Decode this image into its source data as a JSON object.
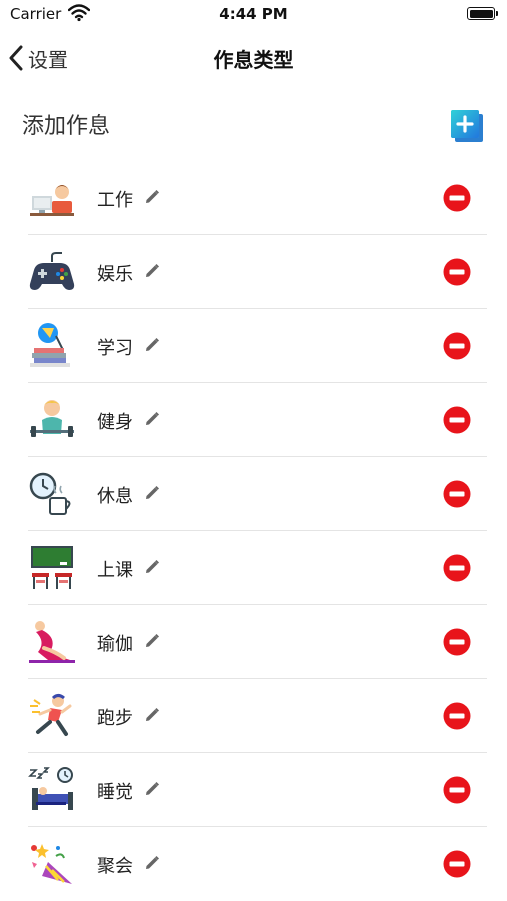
{
  "status_bar": {
    "carrier": "Carrier",
    "time": "4:44 PM"
  },
  "nav": {
    "back_label": "设置",
    "title": "作息类型"
  },
  "section": {
    "title": "添加作息"
  },
  "routines": [
    {
      "label": "工作",
      "icon": "desk-worker-icon"
    },
    {
      "label": "娱乐",
      "icon": "gamepad-icon"
    },
    {
      "label": "学习",
      "icon": "study-lamp-books-icon"
    },
    {
      "label": "健身",
      "icon": "weightlifting-icon"
    },
    {
      "label": "休息",
      "icon": "clock-coffee-icon"
    },
    {
      "label": "上课",
      "icon": "classroom-icon"
    },
    {
      "label": "瑜伽",
      "icon": "yoga-icon"
    },
    {
      "label": "跑步",
      "icon": "running-icon"
    },
    {
      "label": "睡觉",
      "icon": "sleeping-icon"
    },
    {
      "label": "聚会",
      "icon": "party-popper-icon"
    }
  ],
  "colors": {
    "delete": "#e8141b",
    "accent": "#1f8fe0",
    "edit_icon": "#666666"
  }
}
